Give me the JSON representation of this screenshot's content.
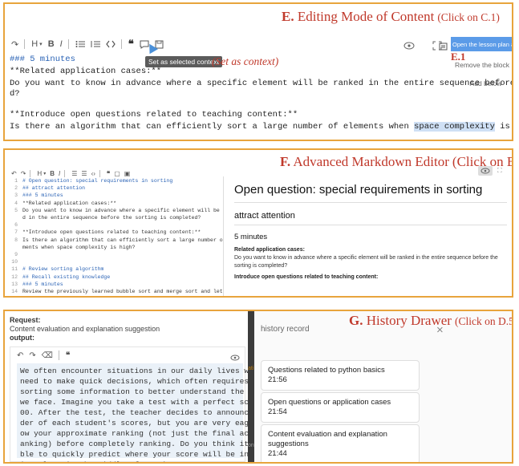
{
  "panel_e": {
    "caption_letter": "E.",
    "caption_title": "Editing Mode of Content",
    "caption_note": "(Click on C.1)",
    "toolbar": {
      "undo": "↶",
      "redo": "↷",
      "heading": "H",
      "bold": "B",
      "italic": "I",
      "quote": "❝",
      "comment": "▢"
    },
    "lines": [
      "### 5 minutes",
      "**Related application cases:**",
      "Do you want to know in advance where a specific element will be ranked in the entire sequence before the sorting is complete",
      "d?",
      "",
      "**Introduce open questions related to teaching content:**",
      "Is there an algorithm that can efficiently sort a large number of elements when "
    ],
    "highlight_text": "space complexity",
    "line6_tail": " is high?",
    "tooltip": "Set as selected context",
    "context_note": "(Set as context)",
    "open_assistant": "Open the lesson plan assistant",
    "sub_label": "E.1",
    "remove_block": "Remove the block",
    "add_below": "Add below"
  },
  "panel_f": {
    "caption_letter": "F.",
    "caption_title": "Advanced Markdown Editor",
    "caption_note": "(Click on B)",
    "editor_lines": [
      {
        "n": "1",
        "t": "# Open question: special requirements in sorting",
        "c": "blue"
      },
      {
        "n": "2",
        "t": "## attract attention",
        "c": "blue"
      },
      {
        "n": "3",
        "t": "### 5 minutes",
        "c": "blue"
      },
      {
        "n": "4",
        "t": "**Related application cases:**",
        "c": "dark"
      },
      {
        "n": "5",
        "t": "Do you want to know in advance where a specific element will be ranke",
        "c": "dark"
      },
      {
        "n": "",
        "t": "d in the entire sequence before the sorting is completed?",
        "c": "dark"
      },
      {
        "n": "6",
        "t": "",
        "c": "dark"
      },
      {
        "n": "7",
        "t": "**Introduce open questions related to teaching content:**",
        "c": "dark"
      },
      {
        "n": "8",
        "t": "Is there an algorithm that can efficiently sort a large number of ele",
        "c": "dark"
      },
      {
        "n": "",
        "t": "ments when space complexity is high?",
        "c": "dark"
      },
      {
        "n": "9",
        "t": "",
        "c": "dark"
      },
      {
        "n": "10",
        "t": "",
        "c": "dark"
      },
      {
        "n": "11",
        "t": "# Review sorting algorithm",
        "c": "blue"
      },
      {
        "n": "12",
        "t": "## Recall existing knowledge",
        "c": "blue"
      },
      {
        "n": "13",
        "t": "### 5 minutes",
        "c": "blue"
      },
      {
        "n": "14",
        "t": "Review the previously learned bubble sort and merge sort and let stud",
        "c": "dark"
      }
    ],
    "preview": {
      "h1": "Open question: special requirements in sorting",
      "h2": "attract attention",
      "h3": "5 minutes",
      "cases_label": "Related application cases:",
      "cases_text": "Do you want to know in advance where a specific element will be ranked in the entire sequence before the sorting is completed?",
      "open_q_label": "Introduce open questions related to teaching content:"
    }
  },
  "panel_g": {
    "caption_letter": "G.",
    "caption_title": "History Drawer",
    "caption_note": "(Click on D.5)",
    "request_label": "Request:",
    "request_value": "Content evaluation and explanation suggestion",
    "output_label": "output:",
    "body_lines": [
      "We often encounter situations in our daily lives where we",
      "need to make quick decisions, which often requires quickly",
      "sorting some information to better understand the choices",
      "we face. Imagine you take a test with a perfect score of 1",
      "00. After the test, the teacher decides to announce the or",
      "der of each student's scores, but you are very eager to kn",
      "ow your approximate ranking (not just the final accurate r",
      "anking) before completely ranking. Do you think it's possi",
      "ble to quickly predict where your score will be in the ent",
      "ire class in the middle of sorting?"
    ],
    "divider_frag1": "ati",
    "divider_frag2": "on",
    "drawer_title": "history record",
    "close": "×",
    "history": [
      {
        "title": "Questions related to python basics",
        "time": "21:56"
      },
      {
        "title": "Open questions or application cases",
        "time": "21:54"
      },
      {
        "title": "Content evaluation and explanation suggestions",
        "time": "21:44"
      }
    ]
  }
}
